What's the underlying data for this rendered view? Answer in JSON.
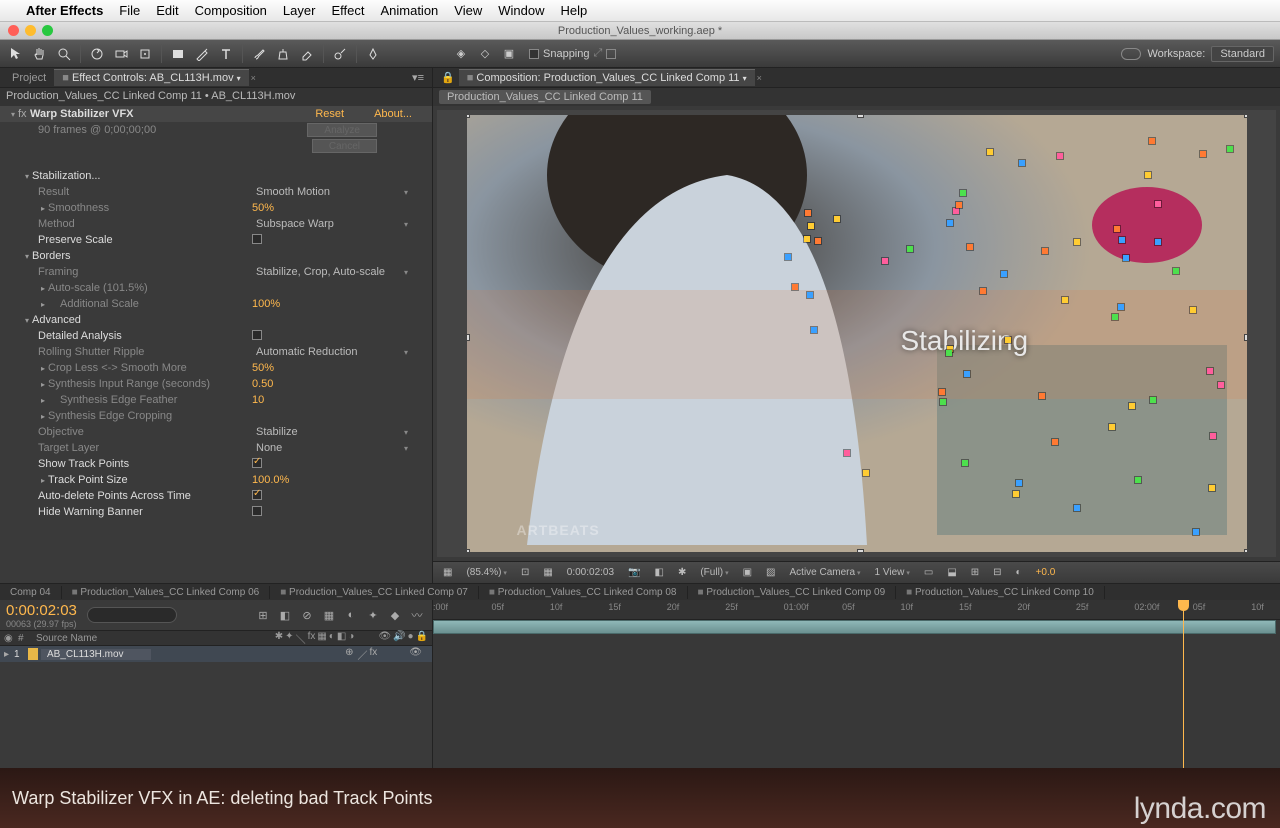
{
  "menubar": {
    "app": "After Effects",
    "items": [
      "File",
      "Edit",
      "Composition",
      "Layer",
      "Effect",
      "Animation",
      "View",
      "Window",
      "Help"
    ]
  },
  "window_title": "Production_Values_working.aep *",
  "toolbar": {
    "snapping": "Snapping",
    "workspace_label": "Workspace:",
    "workspace_value": "Standard"
  },
  "panels": {
    "project_tab": "Project",
    "ec_tab": "Effect Controls: AB_CL113H.mov",
    "breadcrumb": "Production_Values_CC Linked Comp 11 • AB_CL113H.mov"
  },
  "fx": {
    "name": "Warp Stabilizer VFX",
    "reset": "Reset",
    "about": "About...",
    "frames_info": "90 frames @ 0;00;00;00",
    "analyze": "Analyze",
    "cancel": "Cancel",
    "groups": {
      "stabilization": "Stabilization...",
      "borders": "Borders",
      "advanced": "Advanced"
    },
    "props": {
      "result": {
        "label": "Result",
        "value": "Smooth Motion"
      },
      "smoothness": {
        "label": "Smoothness",
        "value": "50%"
      },
      "method": {
        "label": "Method",
        "value": "Subspace Warp"
      },
      "preserve_scale": {
        "label": "Preserve Scale"
      },
      "framing": {
        "label": "Framing",
        "value": "Stabilize, Crop, Auto-scale"
      },
      "autoscale": {
        "label": "Auto-scale (101.5%)"
      },
      "additional_scale": {
        "label": "Additional Scale",
        "value": "100%"
      },
      "detailed_analysis": {
        "label": "Detailed Analysis"
      },
      "rolling_shutter": {
        "label": "Rolling Shutter Ripple",
        "value": "Automatic Reduction"
      },
      "crop_smooth": {
        "label": "Crop Less <-> Smooth More",
        "value": "50%"
      },
      "synth_range": {
        "label": "Synthesis Input Range (seconds)",
        "value": "0.50"
      },
      "synth_feather": {
        "label": "Synthesis Edge Feather",
        "value": "10"
      },
      "synth_crop": {
        "label": "Synthesis Edge Cropping"
      },
      "objective": {
        "label": "Objective",
        "value": "Stabilize"
      },
      "target_layer": {
        "label": "Target Layer",
        "value": "None"
      },
      "show_track": {
        "label": "Show Track Points"
      },
      "track_size": {
        "label": "Track Point Size",
        "value": "100.0%"
      },
      "auto_delete": {
        "label": "Auto-delete Points Across Time"
      },
      "hide_banner": {
        "label": "Hide Warning Banner"
      }
    }
  },
  "comp": {
    "tab": "Composition: Production_Values_CC Linked Comp 11",
    "breadcrumb": "Production_Values_CC Linked Comp 11",
    "overlay": "Stabilizing",
    "watermark": "ARTBEATS"
  },
  "viewer_bar": {
    "zoom": "(85.4%)",
    "timecode": "0:00:02:03",
    "res": "(Full)",
    "camera": "Active Camera",
    "views": "1 View",
    "exposure": "+0.0"
  },
  "timeline": {
    "tabs": [
      "Comp 04",
      "Production_Values_CC Linked Comp 06",
      "Production_Values_CC Linked Comp 07",
      "Production_Values_CC Linked Comp 08",
      "Production_Values_CC Linked Comp 09",
      "Production_Values_CC Linked Comp 10"
    ],
    "timecode": "0:00:02:03",
    "timecode_sub": "00063 (29.97 fps)",
    "col_source": "Source Name",
    "layer_num": "1",
    "layer_name": "AB_CL113H.mov",
    "ticks": [
      ":00f",
      "05f",
      "10f",
      "15f",
      "20f",
      "25f",
      "01:00f",
      "05f",
      "10f",
      "15f",
      "20f",
      "25f",
      "02:00f",
      "05f",
      "10f"
    ]
  },
  "caption": "Warp Stabilizer VFX in AE: deleting bad Track Points",
  "lynda": "lynda.com"
}
